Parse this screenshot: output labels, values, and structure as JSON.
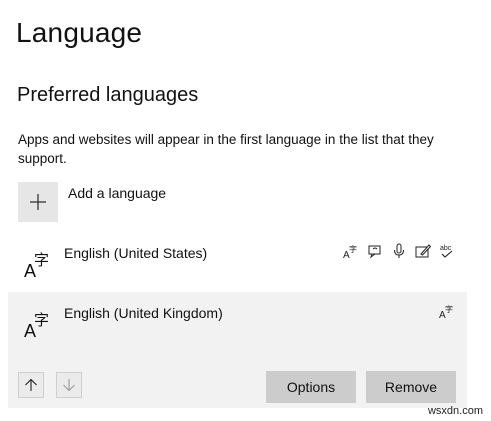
{
  "page": {
    "title": "Language",
    "section_title": "Preferred languages",
    "description": "Apps and websites will appear in the first language in the list that they support."
  },
  "add_language": {
    "label": "Add a language",
    "icon": "plus-icon"
  },
  "languages": [
    {
      "name": "English (United States)",
      "icon": "language-glyph-icon",
      "features": [
        "display-language-icon",
        "text-to-speech-icon",
        "speech-recognition-icon",
        "handwriting-icon",
        "spell-check-icon"
      ],
      "selected": false
    },
    {
      "name": "English (United Kingdom)",
      "icon": "language-glyph-icon",
      "features": [
        "display-language-icon"
      ],
      "selected": true
    }
  ],
  "actions": {
    "options_label": "Options",
    "remove_label": "Remove",
    "move_up_icon": "arrow-up-icon",
    "move_down_icon": "arrow-down-icon"
  },
  "watermark": "wsxdn.com",
  "colors": {
    "selected_row": "#f2f2f2",
    "button": "#cccccc",
    "add_tile": "#e6e6e6"
  }
}
